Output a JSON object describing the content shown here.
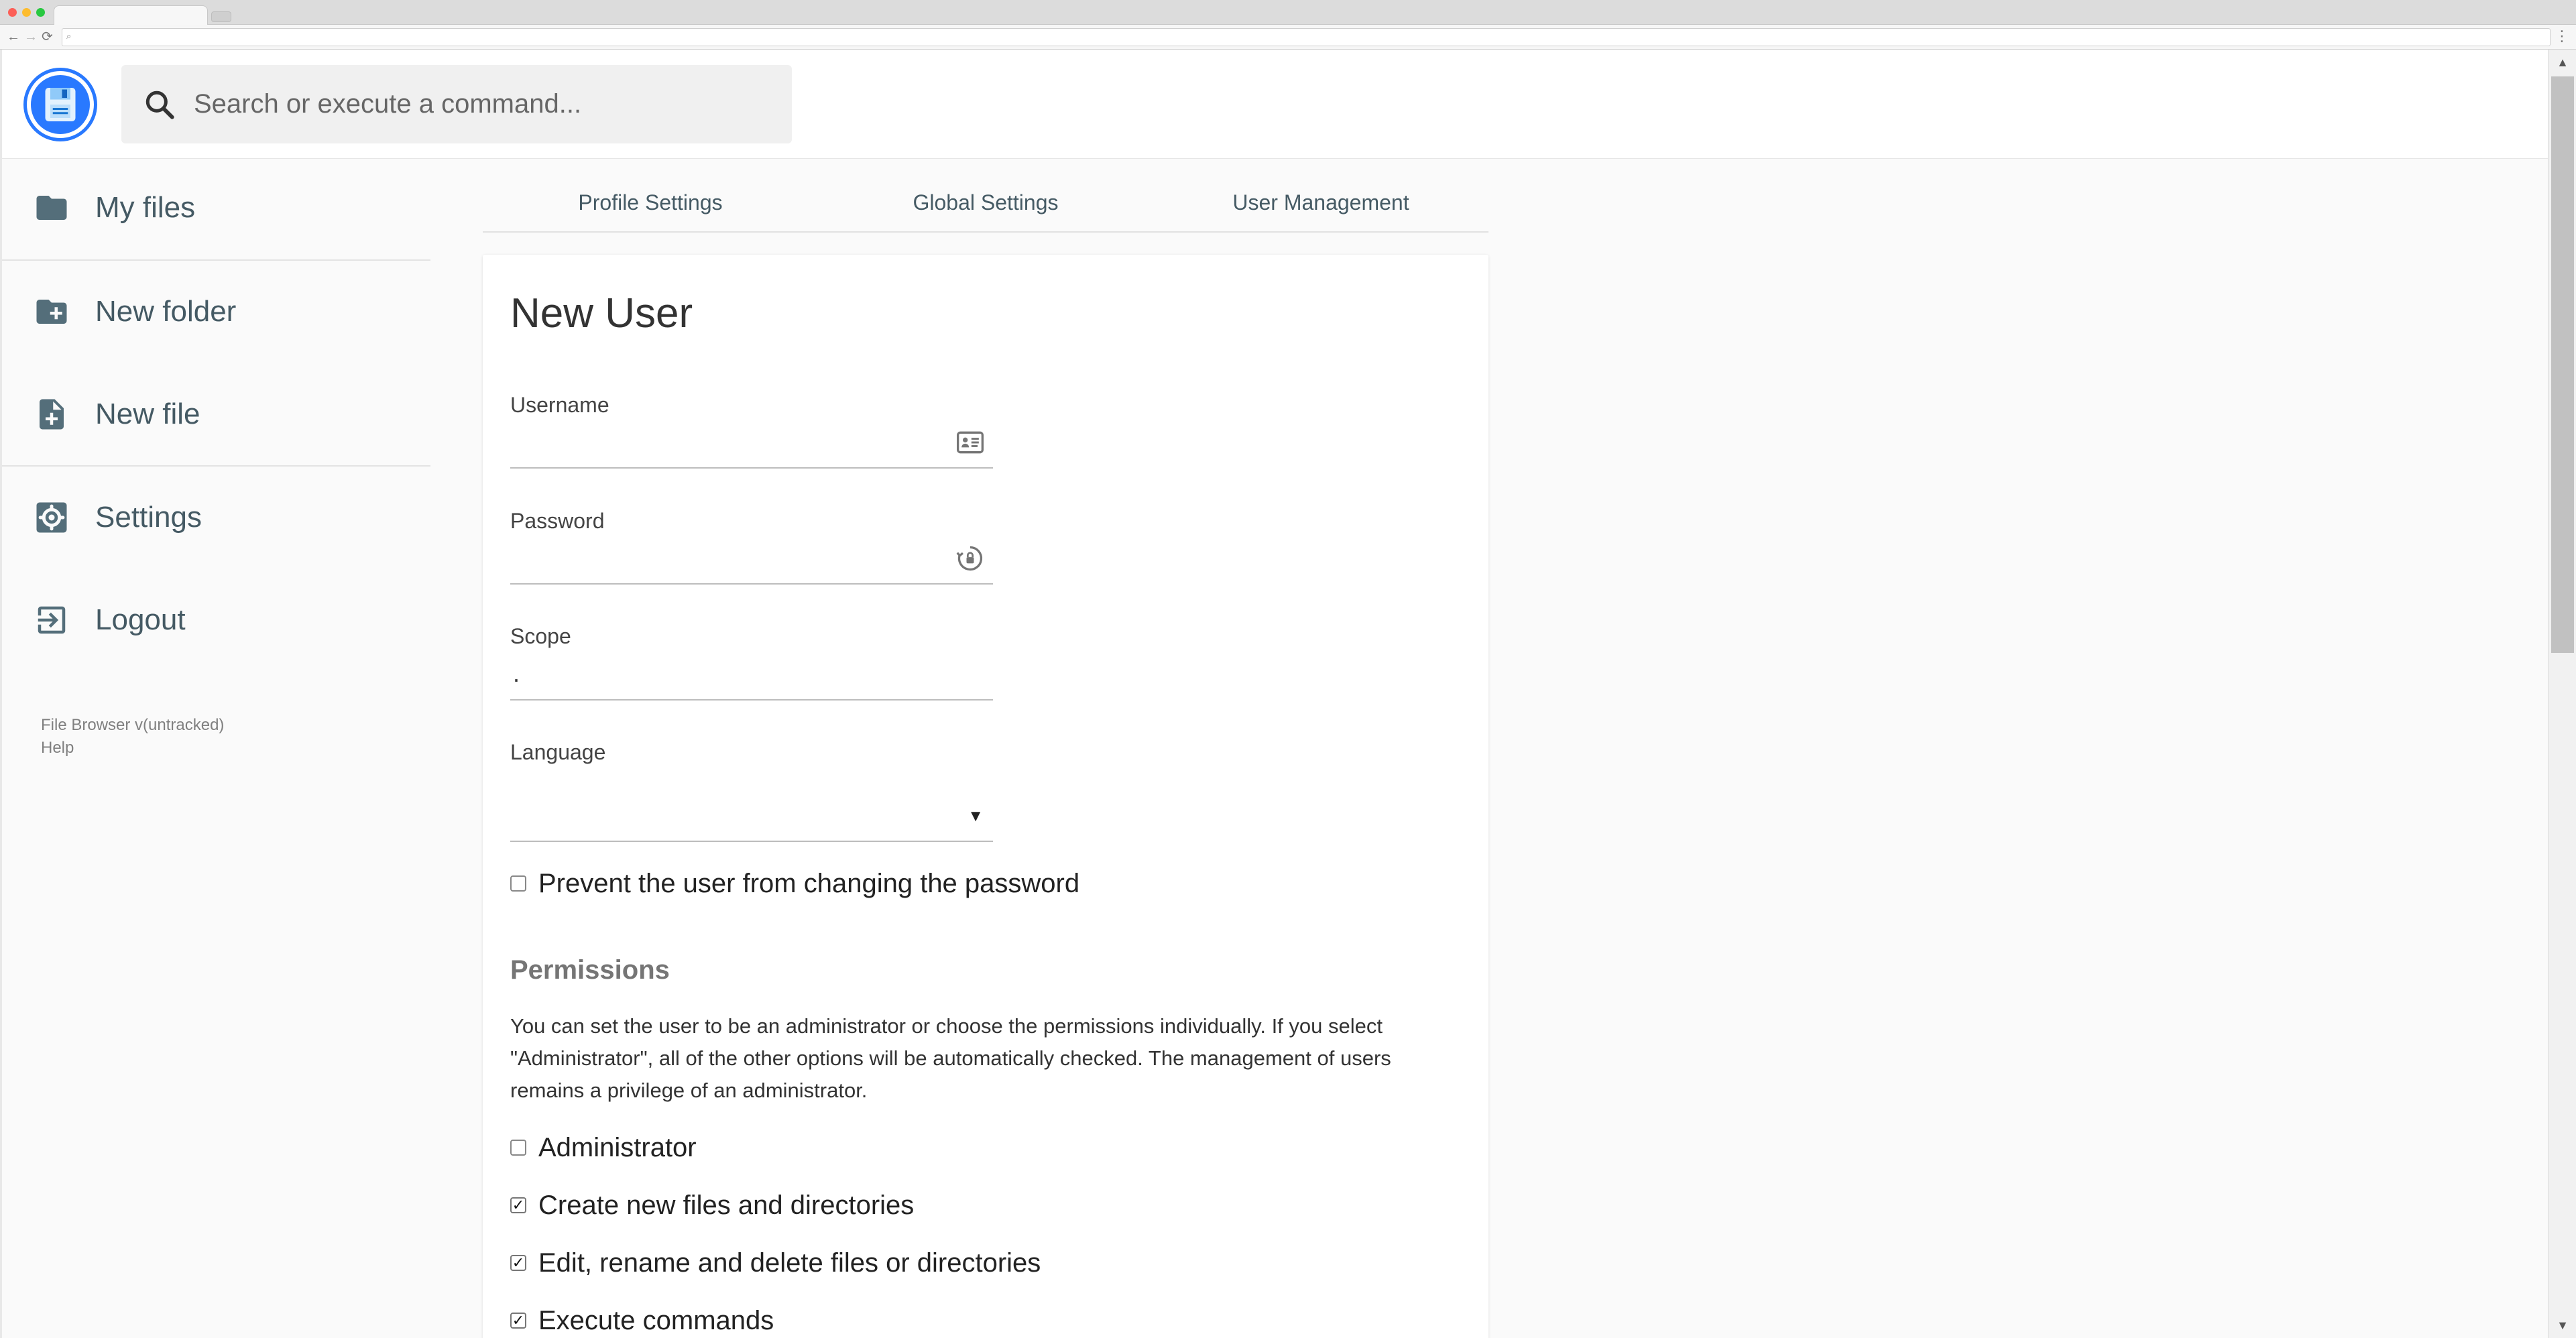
{
  "browser": {
    "back_glyph": "←",
    "forward_glyph": "→",
    "reload_glyph": "⟳",
    "omnibox_glyph": "⌕",
    "menu_glyph": "⋮"
  },
  "search": {
    "placeholder": "Search or execute a command..."
  },
  "sidebar": {
    "items": [
      {
        "label": "My files",
        "icon": "folder-icon"
      },
      {
        "label": "New folder",
        "icon": "create-new-folder-icon"
      },
      {
        "label": "New file",
        "icon": "note-add-icon"
      },
      {
        "label": "Settings",
        "icon": "settings-icon"
      },
      {
        "label": "Logout",
        "icon": "exit-icon"
      }
    ],
    "credits": {
      "version": "File Browser v(untracked)",
      "help": "Help"
    }
  },
  "tabs": [
    {
      "label": "Profile Settings"
    },
    {
      "label": "Global Settings"
    },
    {
      "label": "User Management"
    }
  ],
  "form": {
    "title": "New User",
    "username": {
      "label": "Username",
      "value": ""
    },
    "password": {
      "label": "Password",
      "value": ""
    },
    "scope": {
      "label": "Scope",
      "value": "."
    },
    "language": {
      "label": "Language",
      "value": "",
      "arrow": "▼"
    },
    "lock_password": {
      "label": "Prevent the user from changing the password",
      "checked": false
    },
    "permissions": {
      "title": "Permissions",
      "description": "You can set the user to be an administrator or choose the permissions individually. If you select \"Administrator\", all of the other options will be automatically checked. The management of users remains a privilege of an administrator.",
      "items": [
        {
          "label": "Administrator",
          "checked": false
        },
        {
          "label": "Create new files and directories",
          "checked": true
        },
        {
          "label": "Edit, rename and delete files or directories",
          "checked": true
        },
        {
          "label": "Execute commands",
          "checked": true
        }
      ]
    }
  },
  "scroll": {
    "up": "▲",
    "down": "▼"
  },
  "colors": {
    "accent": "#2979ff",
    "sidebar_text": "#455a64",
    "icon": "#546e7a"
  }
}
